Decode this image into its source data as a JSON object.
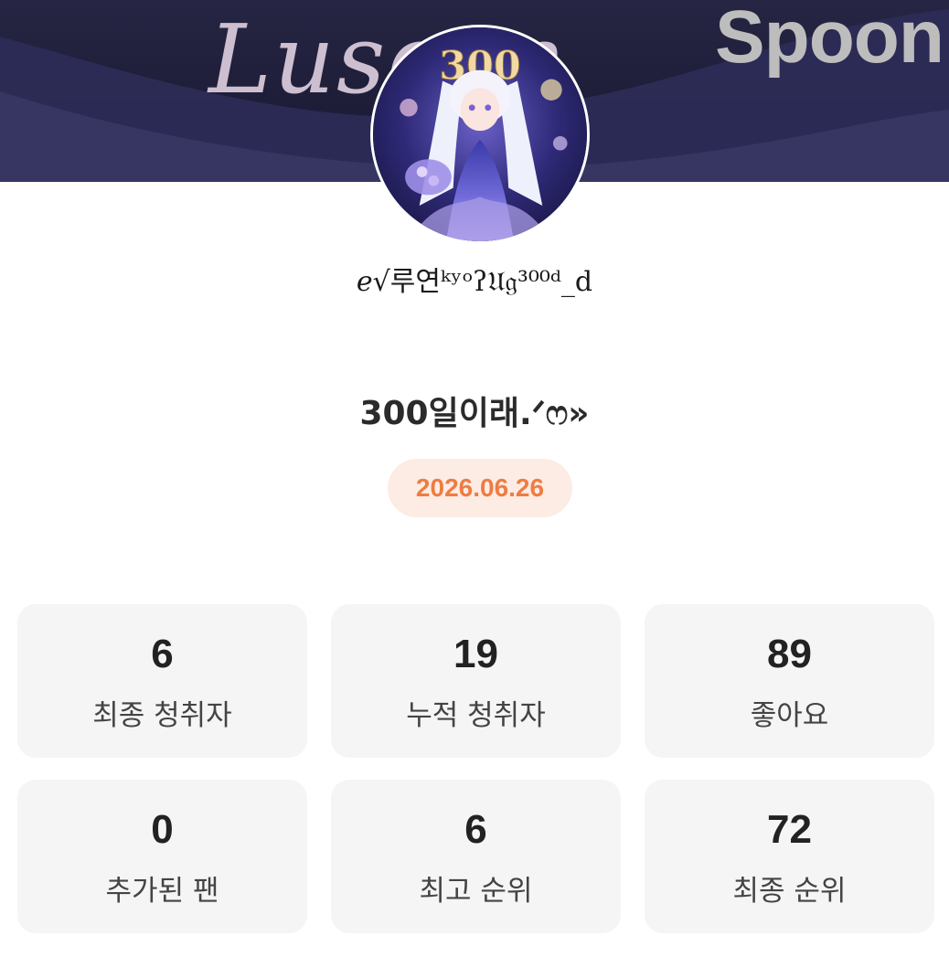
{
  "banner": {
    "script_text": "Luseon",
    "brand": "Spoon",
    "colors": {
      "bg": "#1d1d38",
      "wave": "#3a3866",
      "script": "#cdbfd0",
      "brand": "#bdbdbd"
    }
  },
  "profile": {
    "avatar_icon": "avatar-illustration",
    "nickname": "ℯ√루연ᵏʸᵒʔ𝔘𝔤³⁰⁰ᵈ_d"
  },
  "broadcast": {
    "title": "300일이래.ᐟෆ»",
    "date": "2026.06.26",
    "date_color": "#ef7c42"
  },
  "stats": [
    {
      "value": "6",
      "label": "최종 청취자"
    },
    {
      "value": "19",
      "label": "누적 청취자"
    },
    {
      "value": "89",
      "label": "좋아요"
    },
    {
      "value": "0",
      "label": "추가된 팬"
    },
    {
      "value": "6",
      "label": "최고 순위"
    },
    {
      "value": "72",
      "label": "최종 순위"
    }
  ]
}
